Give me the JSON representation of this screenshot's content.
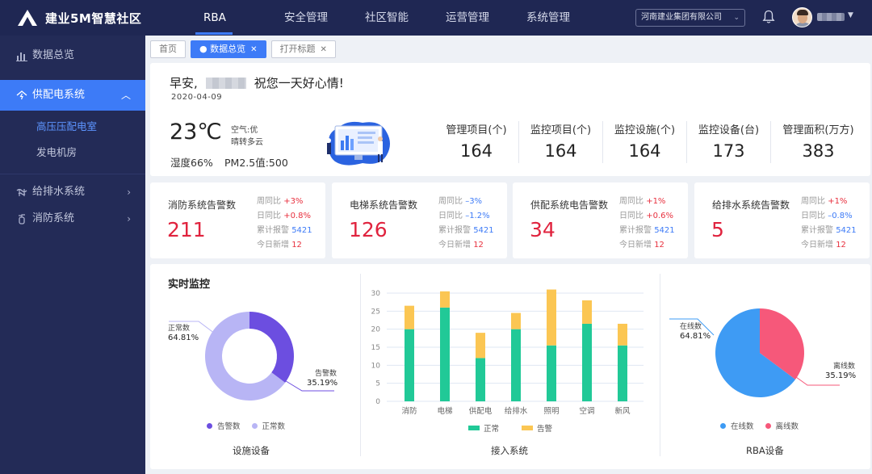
{
  "app": {
    "title": "建业5M智慧社区"
  },
  "nav": [
    {
      "label": "RBA",
      "active": true
    },
    {
      "label": "安全管理",
      "active": false
    },
    {
      "label": "社区智能",
      "active": false
    },
    {
      "label": "运营管理",
      "active": false
    },
    {
      "label": "系统管理",
      "active": false
    }
  ],
  "header": {
    "company": "河南建业集团有限公司"
  },
  "sidebar": {
    "items": [
      {
        "label": "数据总览",
        "icon": "bar-chart-icon"
      },
      {
        "label": "供配电系统",
        "icon": "power-icon",
        "active": true,
        "children": [
          "高压压配电室",
          "发电机房"
        ]
      },
      {
        "label": "给排水系统",
        "icon": "water-icon"
      },
      {
        "label": "消防系统",
        "icon": "fire-extinguisher-icon"
      }
    ]
  },
  "tabs": [
    {
      "label": "首页"
    },
    {
      "label": "数据总览",
      "closable": true,
      "active": true
    },
    {
      "label": "打开标题",
      "closable": true
    }
  ],
  "welcome": {
    "greeting_prefix": "早安,",
    "greeting_suffix": "祝您一天好心情!",
    "date": "2020-04-09",
    "temperature": "23℃",
    "air": "空气:优",
    "weather": "晴转多云",
    "humidity": "湿度66%",
    "pm25": "PM2.5值:500"
  },
  "stats": [
    {
      "label": "管理项目(个)",
      "value": "164"
    },
    {
      "label": "监控项目(个)",
      "value": "164"
    },
    {
      "label": "监控设施(个)",
      "value": "164"
    },
    {
      "label": "监控设备(台)",
      "value": "173"
    },
    {
      "label": "管理面积(万方)",
      "value": "383"
    }
  ],
  "alarms": [
    {
      "title": "消防系统告警数",
      "value": "211",
      "wow_label": "周同比",
      "wow": "+3%",
      "wow_dir": "up",
      "dod_label": "日同比",
      "dod": "+0.8%",
      "dod_dir": "up",
      "total_label": "累计报警",
      "total": "5421",
      "today_label": "今日新增",
      "today": "12"
    },
    {
      "title": "电梯系统告警数",
      "value": "126",
      "wow_label": "周同比",
      "wow": "–3%",
      "wow_dir": "down",
      "dod_label": "日同比",
      "dod": "–1.2%",
      "dod_dir": "down",
      "total_label": "累计报警",
      "total": "5421",
      "today_label": "今日新增",
      "today": "12"
    },
    {
      "title": "供配系统电告警数",
      "value": "34",
      "wow_label": "周同比",
      "wow": "+1%",
      "wow_dir": "up",
      "dod_label": "日同比",
      "dod": "+0.6%",
      "dod_dir": "up",
      "total_label": "累计报警",
      "total": "5421",
      "today_label": "今日新增",
      "today": "12"
    },
    {
      "title": "给排水系统告警数",
      "value": "5",
      "wow_label": "周同比",
      "wow": "+1%",
      "wow_dir": "up",
      "dod_label": "日同比",
      "dod": "–0.8%",
      "dod_dir": "down",
      "total_label": "累计报警",
      "total": "5421",
      "today_label": "今日新增",
      "today": "12"
    }
  ],
  "monitor": {
    "title": "实时监控",
    "colors": {
      "alarm": "#6c4ee0",
      "normal": "#b8b5f5",
      "bar_normal": "#21c997",
      "bar_alarm": "#fbc653",
      "online": "#3e9bf4",
      "offline": "#f6587a"
    },
    "chart_data": [
      {
        "type": "pie",
        "title": "设施设备",
        "donut": true,
        "slices": [
          {
            "name": "告警数",
            "value": 35.19,
            "label": "35.19%"
          },
          {
            "name": "正常数",
            "value": 64.81,
            "label": "64.81%"
          }
        ],
        "legend_position": "bottom"
      },
      {
        "type": "bar",
        "stacked": true,
        "title": "接入系统",
        "categories": [
          "消防",
          "电梯",
          "供配电",
          "给排水",
          "照明",
          "空调",
          "新风"
        ],
        "series": [
          {
            "name": "正常",
            "values": [
              20,
              26,
              12,
              20,
              15.5,
              21.5,
              15.5
            ]
          },
          {
            "name": "告警",
            "values": [
              6.5,
              4.5,
              7,
              4.5,
              15.5,
              6.5,
              6
            ]
          }
        ],
        "ylim": [
          0,
          30
        ],
        "yticks": [
          "0",
          "5",
          "10",
          "15",
          "20",
          "25",
          "30"
        ],
        "grid": true,
        "legend_position": "bottom"
      },
      {
        "type": "pie",
        "title": "RBA设备",
        "slices": [
          {
            "name": "在线数",
            "value": 64.81,
            "label": "64.81%"
          },
          {
            "name": "离线数",
            "value": 35.19,
            "label": "35.19%"
          }
        ],
        "legend_position": "bottom"
      }
    ]
  }
}
